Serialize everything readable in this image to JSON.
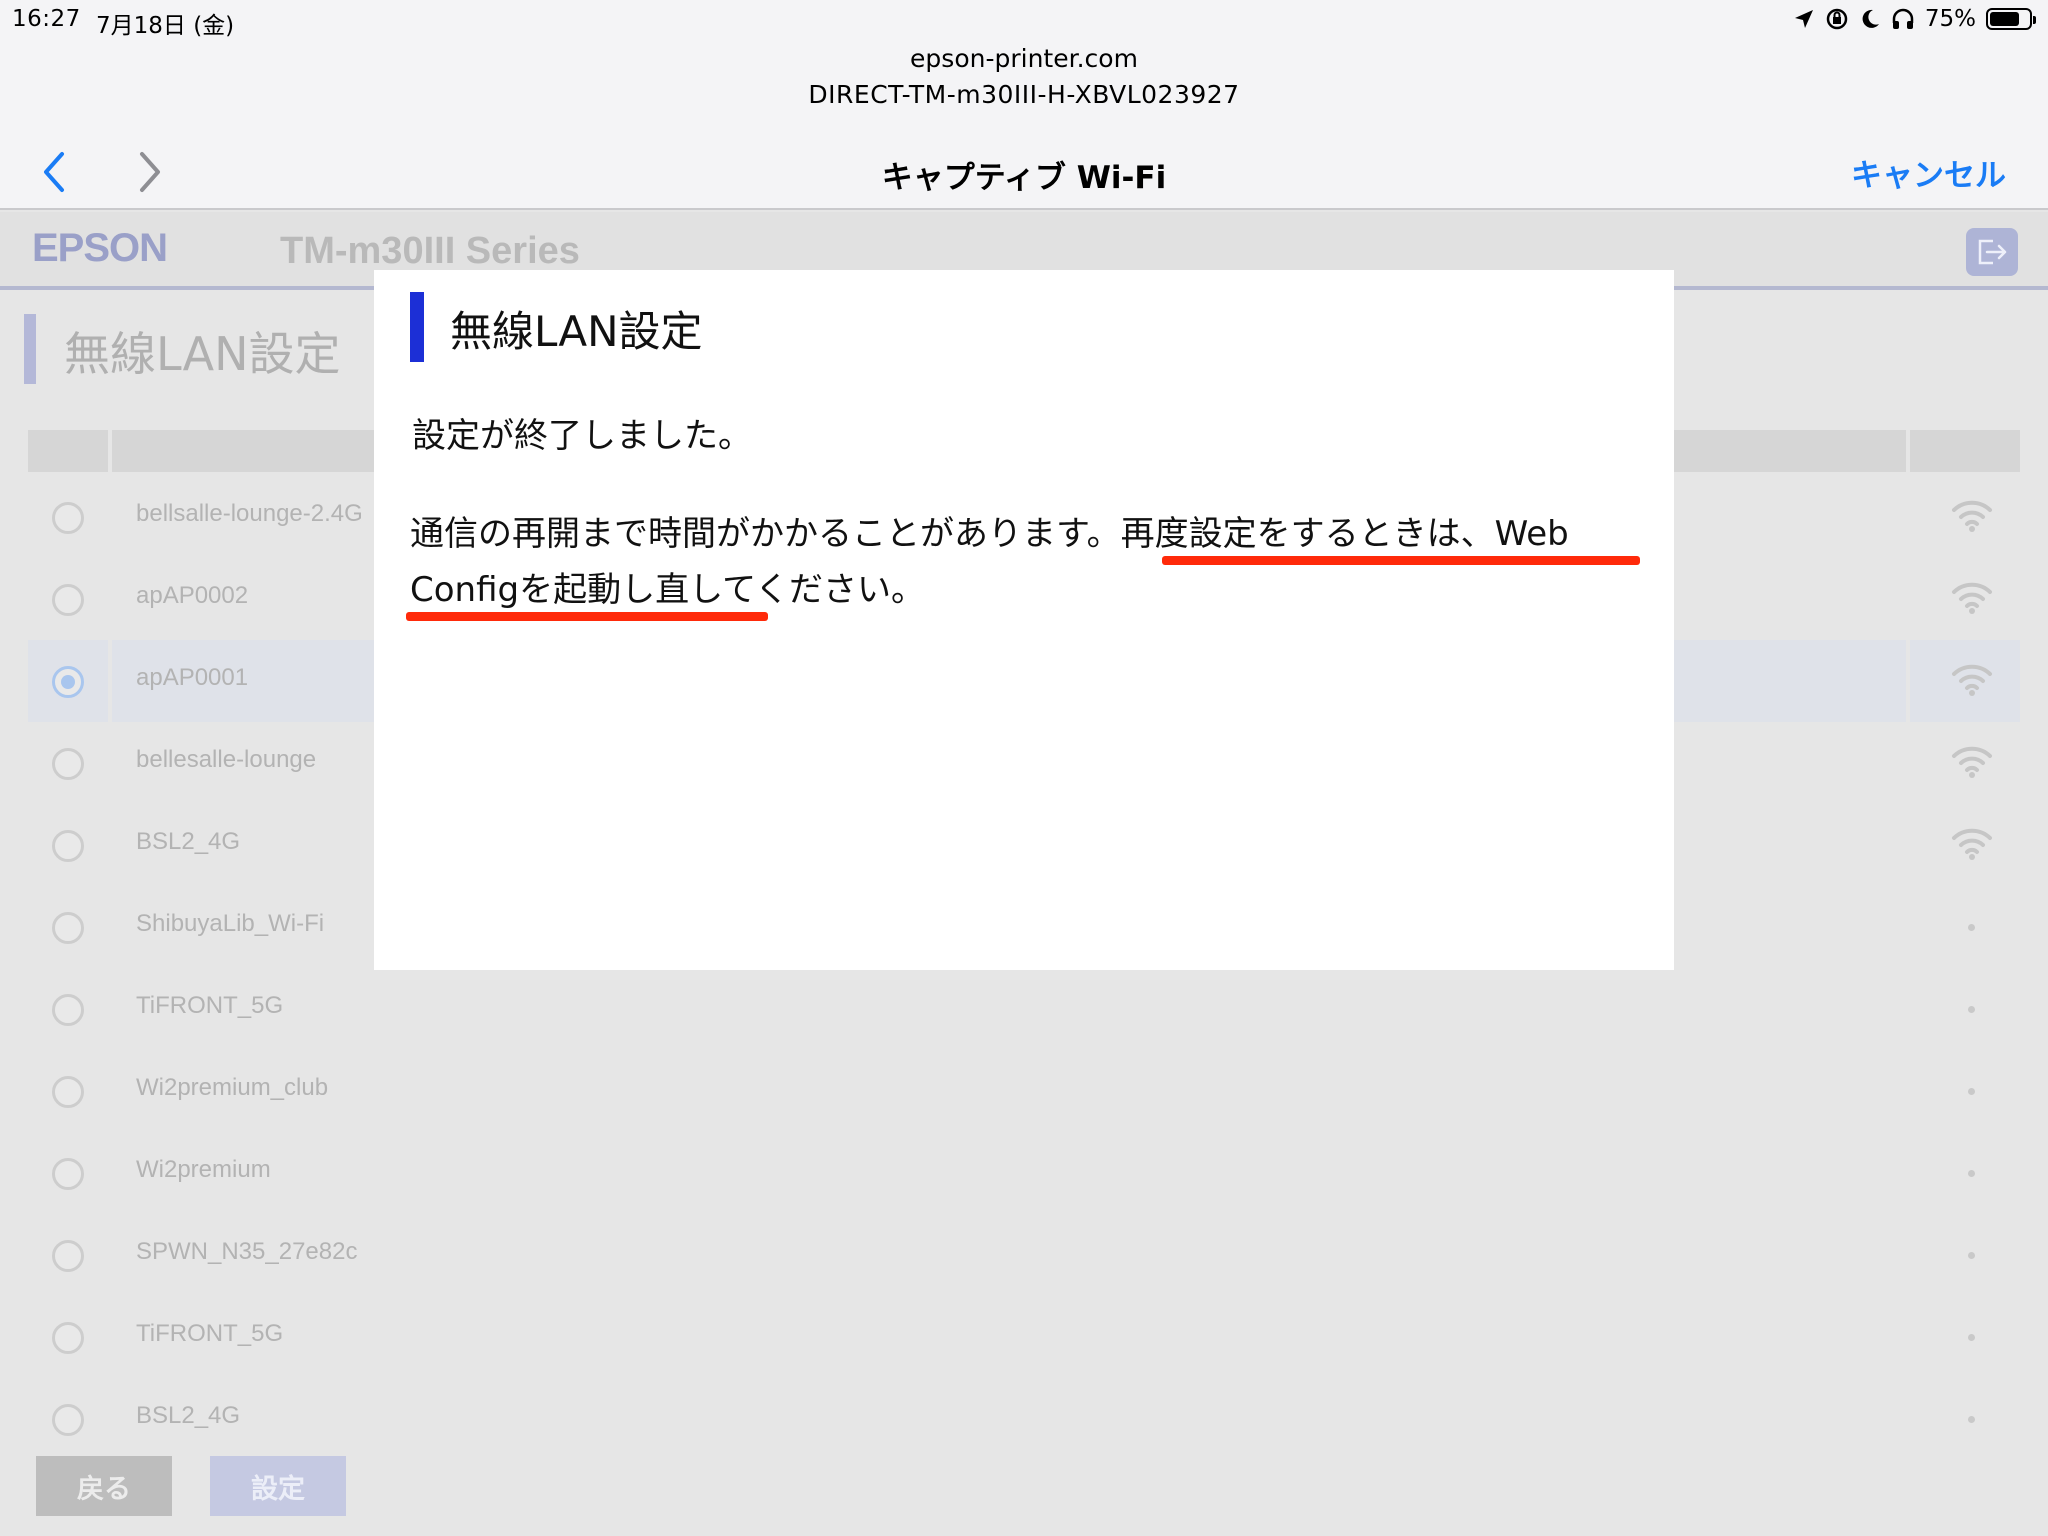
{
  "status_bar": {
    "time": "16:27",
    "date": "7月18日 (金)",
    "battery": "75%",
    "battery_level": 0.75,
    "icons": [
      "location-icon",
      "orientation-lock-icon",
      "moon-icon",
      "headphones-icon",
      "battery-icon"
    ]
  },
  "captive_sheet": {
    "domain": "epson-printer.com",
    "ssid": "DIRECT-TM-m30III-H-XBVL023927",
    "title": "キャプティブ Wi-Fi",
    "cancel_label": "キャンセル"
  },
  "page": {
    "brand": "EPSON",
    "model": "TM-m30III Series",
    "section_title": "無線LAN設定",
    "networks": [
      {
        "name": "bellsalle-lounge-2.4G",
        "selected": false,
        "signal": "wifi-icon"
      },
      {
        "name": "apAP0002",
        "selected": false,
        "signal": "wifi-icon"
      },
      {
        "name": "apAP0001",
        "selected": true,
        "signal": "wifi-icon"
      },
      {
        "name": "bellesalle-lounge",
        "selected": false,
        "signal": "wifi-icon"
      },
      {
        "name": "BSL2_4G",
        "selected": false,
        "signal": "wifi-icon"
      },
      {
        "name": "ShibuyaLib_Wi-Fi",
        "selected": false,
        "signal": "dot"
      },
      {
        "name": "TiFRONT_5G",
        "selected": false,
        "signal": "dot"
      },
      {
        "name": "Wi2premium_club",
        "selected": false,
        "signal": "dot"
      },
      {
        "name": "Wi2premium",
        "selected": false,
        "signal": "dot"
      },
      {
        "name": "SPWN_N35_27e82c",
        "selected": false,
        "signal": "dot"
      },
      {
        "name": "TiFRONT_5G",
        "selected": false,
        "signal": "dot"
      },
      {
        "name": "BSL2_4G",
        "selected": false,
        "signal": "dot"
      }
    ],
    "back_button": "戻る",
    "set_button": "設定"
  },
  "modal": {
    "title": "無線LAN設定",
    "message1": "設定が終了しました。",
    "message2": "通信の再開まで時間がかかることがあります。再度設定をするときは、Web Configを起動し直してください。"
  },
  "colors": {
    "accent_blue": "#1a7cf5",
    "modal_title_mark": "#1c2fd6",
    "annotation_red": "#ff2a0a"
  }
}
